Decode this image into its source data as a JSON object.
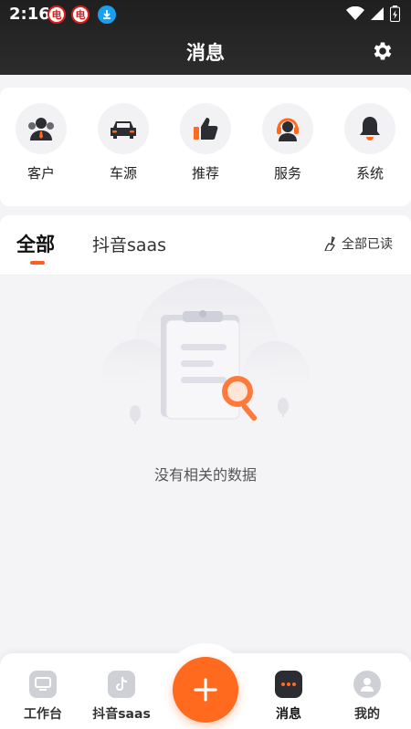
{
  "status_bar": {
    "time": "2:16",
    "badge1": "电",
    "badge2": "电"
  },
  "header": {
    "title": "消息"
  },
  "categories": [
    {
      "label": "客户",
      "icon": "customer-icon"
    },
    {
      "label": "车源",
      "icon": "car-icon"
    },
    {
      "label": "推荐",
      "icon": "thumbs-up-icon"
    },
    {
      "label": "服务",
      "icon": "service-headset-icon"
    },
    {
      "label": "系统",
      "icon": "bell-icon"
    }
  ],
  "tabs": {
    "all": "全部",
    "douyin": "抖音saas",
    "mark_all_read": "全部已读"
  },
  "empty": {
    "text": "没有相关的数据"
  },
  "bottom_nav": [
    {
      "label": "工作台",
      "icon": "workbench-icon"
    },
    {
      "label": "抖音saas",
      "icon": "tiktok-icon"
    },
    {
      "label": "消息",
      "icon": "message-icon",
      "active": true
    },
    {
      "label": "我的",
      "icon": "profile-icon"
    }
  ],
  "colors": {
    "accent": "#ff6a1f",
    "header_bg": "#222222",
    "icon_dark": "#2b2d33"
  }
}
